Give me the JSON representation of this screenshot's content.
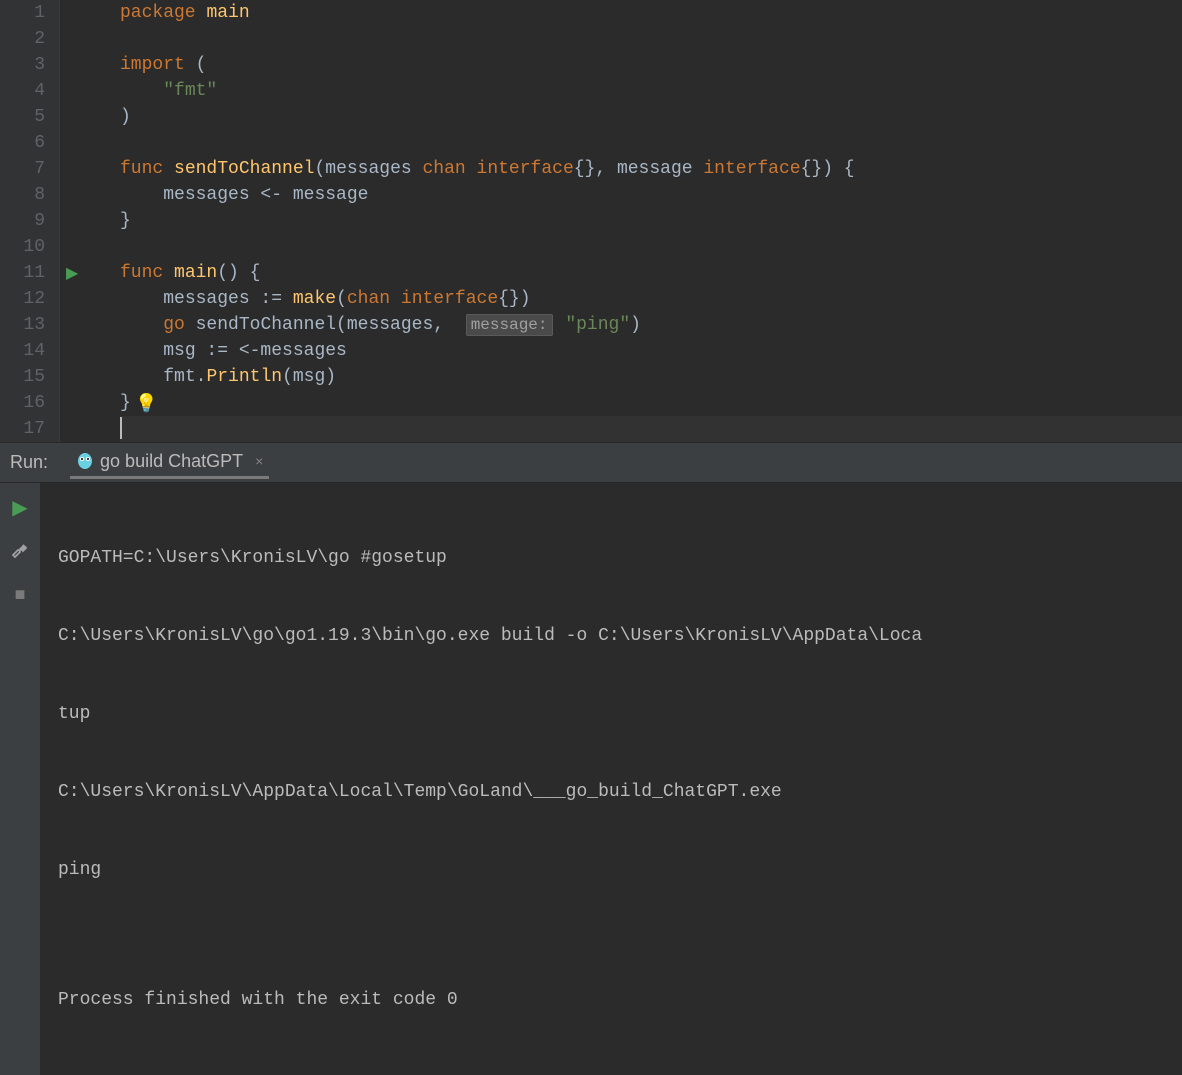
{
  "editor": {
    "line_numbers": [
      "1",
      "2",
      "3",
      "4",
      "5",
      "6",
      "7",
      "8",
      "9",
      "10",
      "11",
      "12",
      "13",
      "14",
      "15",
      "16",
      "17"
    ],
    "code": {
      "l1": {
        "kw1": "package",
        "id1": "main"
      },
      "l3": {
        "kw1": "import",
        "p1": " ("
      },
      "l4": {
        "indent": "    ",
        "str1": "\"fmt\""
      },
      "l5": {
        "p1": ")"
      },
      "l7": {
        "kw1": "func",
        "fn1": "sendToChannel",
        "p1": "(messages ",
        "kw2": "chan",
        "p2": " ",
        "kw3": "interface",
        "p3": "{}, message ",
        "kw4": "interface",
        "p4": "{}) {"
      },
      "l8": {
        "indent": "    ",
        "t1": "messages <- message"
      },
      "l9": {
        "p1": "}"
      },
      "l11": {
        "kw1": "func",
        "fn1": "main",
        "p1": "() {"
      },
      "l12": {
        "indent": "    ",
        "t1": "messages := ",
        "fn1": "make",
        "p1": "(",
        "kw1": "chan",
        "p2": " ",
        "kw2": "interface",
        "p3": "{})"
      },
      "l13": {
        "indent": "    ",
        "kw1": "go",
        "t1": " sendToChannel(messages,  ",
        "hint": "message:",
        "sp": " ",
        "str1": "\"ping\"",
        "p1": ")"
      },
      "l14": {
        "indent": "    ",
        "t1": "msg := <-messages"
      },
      "l15": {
        "indent": "    ",
        "t1": "fmt.",
        "fn1": "Println",
        "p1": "(msg)"
      },
      "l16": {
        "p1": "}"
      }
    }
  },
  "run": {
    "label": "Run:",
    "tab_title": "go build ChatGPT",
    "close_symbol": "×",
    "output_lines": [
      "GOPATH=C:\\Users\\KronisLV\\go #gosetup",
      "C:\\Users\\KronisLV\\go\\go1.19.3\\bin\\go.exe build -o C:\\Users\\KronisLV\\AppData\\Loca",
      "tup",
      "C:\\Users\\KronisLV\\AppData\\Local\\Temp\\GoLand\\___go_build_ChatGPT.exe",
      "ping",
      "",
      "Process finished with the exit code 0"
    ]
  },
  "icons": {
    "run_triangle": "▶",
    "bulb": "💡",
    "stop": "■"
  }
}
